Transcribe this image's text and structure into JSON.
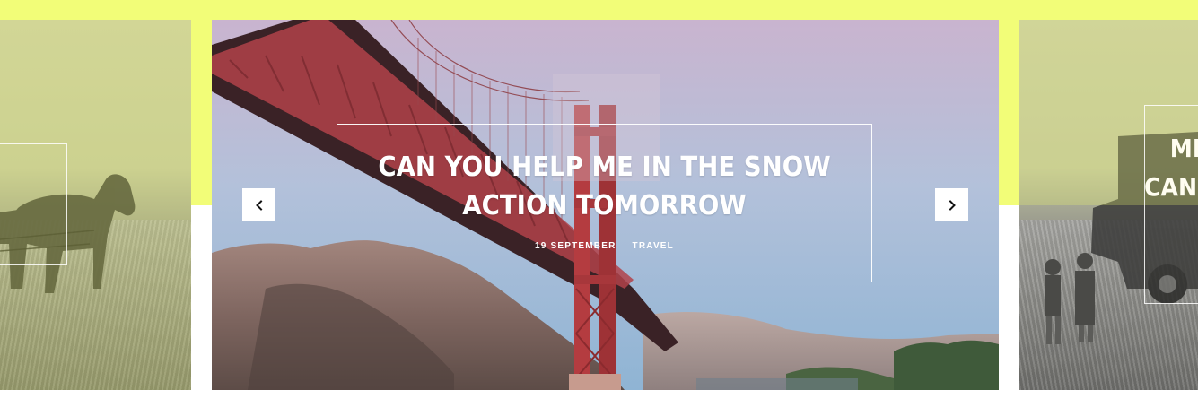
{
  "carousel": {
    "active_slide": {
      "title": "CAN YOU HELP ME IN THE SNOW ACTION TOMORROW",
      "date": "19 SEPTEMBER",
      "category": "TRAVEL"
    },
    "next_slide_partial_title": [
      "ME",
      "CAN"
    ],
    "prev_button_icon": "chevron-left-icon",
    "next_button_icon": "chevron-right-icon",
    "prev_button_glyph": "‹",
    "next_button_glyph": "›"
  },
  "colors": {
    "accent_band": "#f2fd78",
    "button_bg": "#ffffff",
    "caption_text": "#ffffff"
  }
}
